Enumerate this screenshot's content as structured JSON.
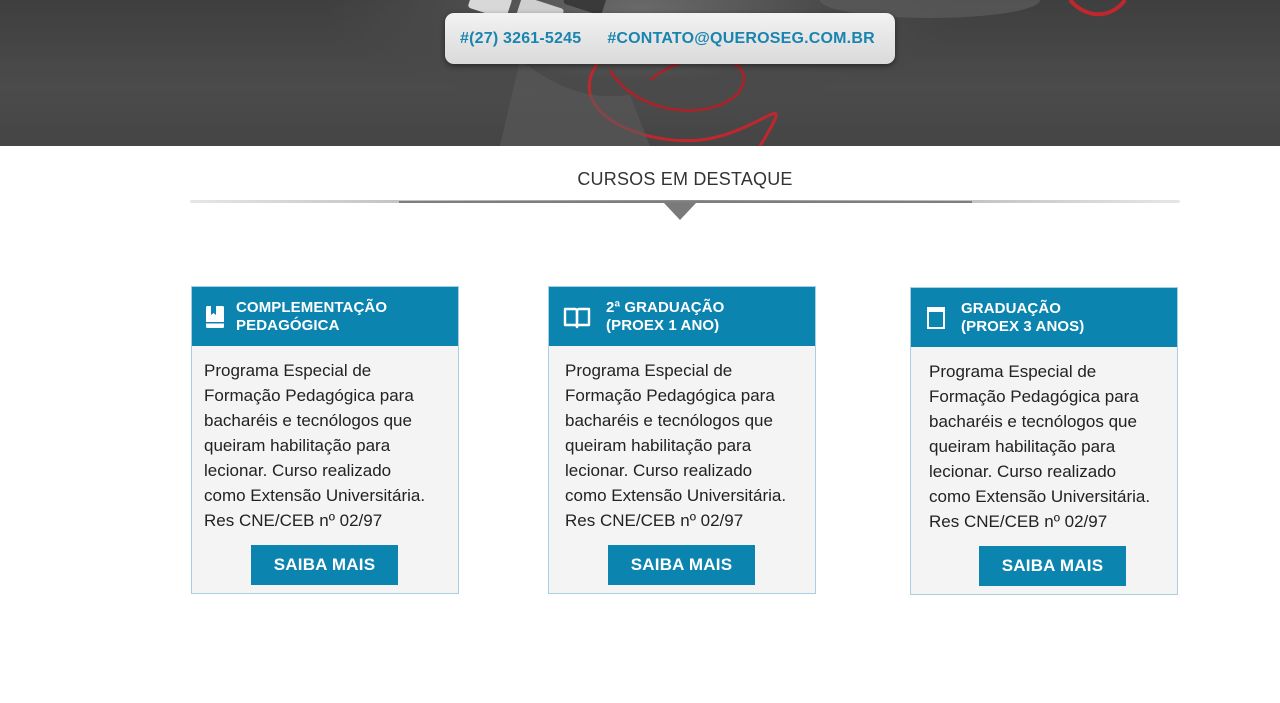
{
  "colors": {
    "brand": "#0c84b0",
    "card_bg": "#f5f4f5",
    "card_border": "#a9cfe2",
    "hero_bg": "#454545"
  },
  "hero": {
    "phone": "#(27) 3261-5245",
    "email": "#CONTATO@QUEROSEG.COM.BR"
  },
  "section": {
    "title": "CURSOS EM DESTAQUE"
  },
  "cards": [
    {
      "icon": "bookmark-book-icon",
      "title_line1": "COMPLEMENTAÇÃO",
      "title_line2": "PEDAGÓGICA",
      "description": "Programa Especial de\nFormação Pedagógica para\nbacharéis e tecnólogos que\nqueiram habilitação para\nlecionar. Curso realizado\ncomo Extensão Universitária.\n Res CNE/CEB nº 02/97",
      "button_label": "SAIBA MAIS"
    },
    {
      "icon": "open-book-icon",
      "title_line1": "2ª GRADUAÇÃO",
      "title_line2": "(PROEX 1 ANO)",
      "description": "Programa Especial de\nFormação Pedagógica para\nbacharéis e tecnólogos que\nqueiram habilitação para\nlecionar. Curso realizado\ncomo Extensão Universitária.\n Res CNE/CEB nº 02/97",
      "button_label": "SAIBA MAIS"
    },
    {
      "icon": "notebook-icon",
      "title_line1": "GRADUAÇÃO",
      "title_line2": "(PROEX 3 ANOS)",
      "description": "Programa Especial de\nFormação Pedagógica para\nbacharéis e tecnólogos que\nqueiram habilitação para\nlecionar. Curso realizado\ncomo Extensão Universitária.\n Res CNE/CEB nº 02/97",
      "button_label": "SAIBA MAIS"
    }
  ]
}
